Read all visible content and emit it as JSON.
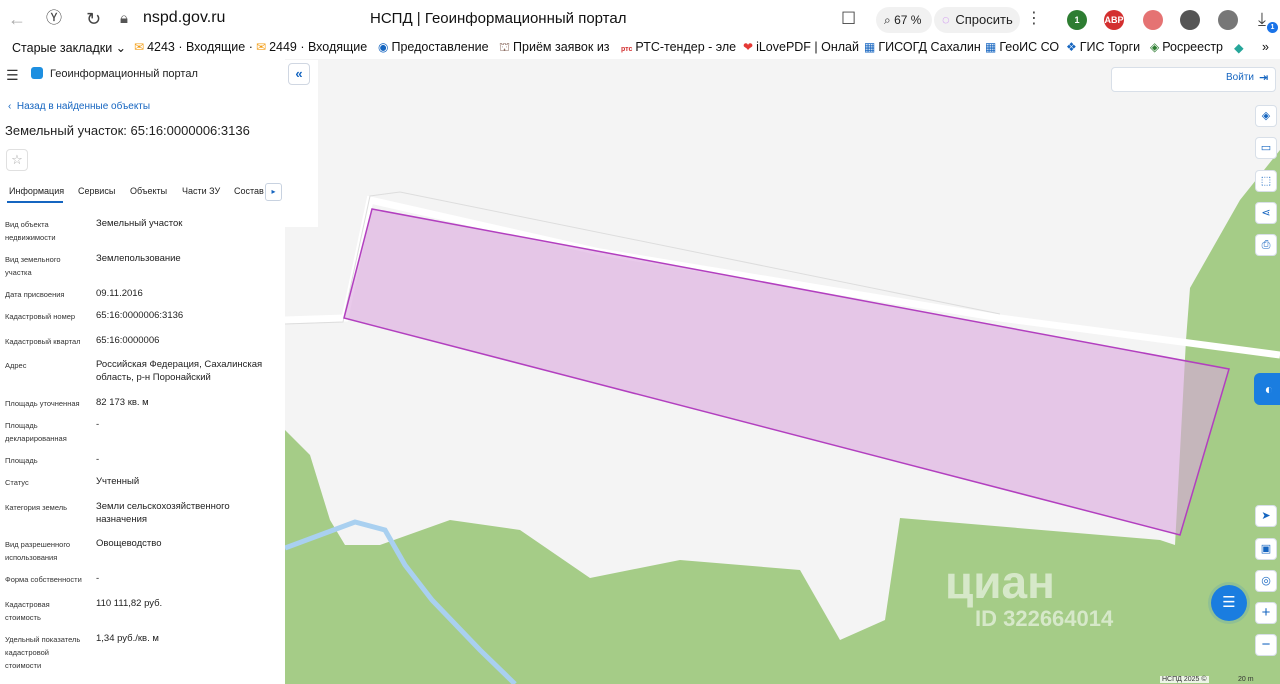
{
  "browser": {
    "url": "nspd.gov.ru",
    "title": "НСПД | Геоинформационный портал",
    "zoom": "67 %",
    "ask_label": "Спросить",
    "extensions": [
      {
        "name": "ext-1",
        "label": "1",
        "color": "#2e7d32"
      },
      {
        "name": "adblock",
        "label": "ABP",
        "color": "#d32f2f"
      },
      {
        "name": "ext-3",
        "label": "",
        "color": "#e57373"
      },
      {
        "name": "ext-4",
        "label": "",
        "color": "#555555"
      },
      {
        "name": "ext-5",
        "label": "",
        "color": "#777777"
      }
    ],
    "downloads_badge": "1"
  },
  "bookmarks": [
    {
      "label": "Старые закладки ⌄",
      "icon": ""
    },
    {
      "label": "4243 · Входящие ·",
      "icon": "✉"
    },
    {
      "label": "2449 · Входящие",
      "icon": "✉"
    },
    {
      "label": "Предоставление",
      "icon": "◉"
    },
    {
      "label": "Приём заявок из",
      "icon": "⛫"
    },
    {
      "label": "РТС-тендер - эле",
      "icon": "ртс"
    },
    {
      "label": "iLovePDF | Онлай",
      "icon": "❤"
    },
    {
      "label": "ГИСОГД Сахалин",
      "icon": "▦"
    },
    {
      "label": "ГеоИС СО",
      "icon": "▦"
    },
    {
      "label": "ГИС Торги",
      "icon": "❖"
    },
    {
      "label": "Росреестр",
      "icon": "◈"
    },
    {
      "label": "»",
      "icon": ""
    }
  ],
  "panel": {
    "portal_name": "Геоинформационный портал",
    "back_label": "Назад в найденные объекты",
    "title": "Земельный участок: 65:16:0000006:3136",
    "tabs": [
      "Информация",
      "Сервисы",
      "Объекты",
      "Части ЗУ",
      "Состав"
    ],
    "active_tab": "Информация",
    "rows": [
      {
        "label": "Вид объекта недвижимости",
        "value": "Земельный участок"
      },
      {
        "label": "Вид земельного участка",
        "value": "Землепользование"
      },
      {
        "label": "Дата присвоения",
        "value": "09.11.2016"
      },
      {
        "label": "Кадастровый номер",
        "value": "65:16:0000006:3136"
      },
      {
        "label": "Кадастровый квартал",
        "value": "65:16:0000006"
      },
      {
        "label": "Адрес",
        "value": "Российская Федерация, Сахалинская область, р-н Поронайский"
      },
      {
        "label": "Площадь уточненная",
        "value": "82 173 кв. м"
      },
      {
        "label": "Площадь декларированная",
        "value": "-"
      },
      {
        "label": "Площадь",
        "value": "-"
      },
      {
        "label": "Статус",
        "value": "Учтенный"
      },
      {
        "label": "Категория земель",
        "value": "Земли сельскохозяйственного назначения"
      },
      {
        "label": "Вид разрешенного использования",
        "value": "Овощеводство"
      },
      {
        "label": "Форма собственности",
        "value": "-"
      },
      {
        "label": "Кадастровая стоимость",
        "value": "110 111,82 руб."
      },
      {
        "label": "Удельный показатель кадастровой стоимости",
        "value": "1,34 руб./кв. м"
      }
    ]
  },
  "map": {
    "login_label": "Войти",
    "watermark": "циан",
    "watermark_id": "ID 322664014",
    "attribution": "НСПД 2025 ©",
    "scale_label": "20 m",
    "colors": {
      "background": "#f4f4f4",
      "vegetation": "#a5cc87",
      "parcel_fill": "#e6c8e6",
      "parcel_stroke": "#b23fbf",
      "river": "#a9d0f0",
      "road": "#ffffff",
      "accent": "#1565c0"
    }
  }
}
